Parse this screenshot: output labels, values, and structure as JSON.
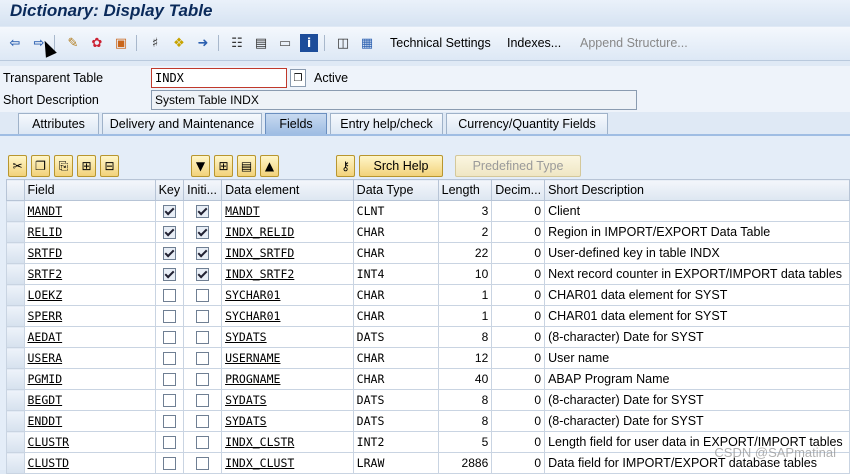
{
  "window": {
    "title": "Dictionary: Display Table"
  },
  "toolbar": {
    "technical_settings": "Technical Settings",
    "indexes": "Indexes...",
    "append_structure": "Append Structure..."
  },
  "header": {
    "table_type_label": "Transparent Table",
    "table_name": "INDX",
    "status": "Active",
    "short_desc_label": "Short Description",
    "short_desc_value": "System Table INDX"
  },
  "tabs": [
    {
      "label": "Attributes"
    },
    {
      "label": "Delivery and Maintenance"
    },
    {
      "label": "Fields",
      "active": true
    },
    {
      "label": "Entry help/check"
    },
    {
      "label": "Currency/Quantity Fields"
    }
  ],
  "grid_toolbar": {
    "srch_help": "Srch Help",
    "predefined_type": "Predefined Type"
  },
  "columns": [
    "Field",
    "Key",
    "Initi...",
    "Data element",
    "Data Type",
    "Length",
    "Decim...",
    "Short Description"
  ],
  "rows": [
    {
      "field": "MANDT",
      "key": true,
      "init": true,
      "element": "MANDT",
      "type": "CLNT",
      "length": "3",
      "dec": "0",
      "desc": "Client"
    },
    {
      "field": "RELID",
      "key": true,
      "init": true,
      "element": "INDX_RELID",
      "type": "CHAR",
      "length": "2",
      "dec": "0",
      "desc": "Region in IMPORT/EXPORT Data Table"
    },
    {
      "field": "SRTFD",
      "key": true,
      "init": true,
      "element": "INDX_SRTFD",
      "type": "CHAR",
      "length": "22",
      "dec": "0",
      "desc": "User-defined key in table INDX"
    },
    {
      "field": "SRTF2",
      "key": true,
      "init": true,
      "element": "INDX_SRTF2",
      "type": "INT4",
      "length": "10",
      "dec": "0",
      "desc": "Next record counter in EXPORT/IMPORT data tables"
    },
    {
      "field": "LOEKZ",
      "key": false,
      "init": false,
      "element": "SYCHAR01",
      "type": "CHAR",
      "length": "1",
      "dec": "0",
      "desc": "CHAR01 data element for SYST"
    },
    {
      "field": "SPERR",
      "key": false,
      "init": false,
      "element": "SYCHAR01",
      "type": "CHAR",
      "length": "1",
      "dec": "0",
      "desc": "CHAR01 data element for SYST"
    },
    {
      "field": "AEDAT",
      "key": false,
      "init": false,
      "element": "SYDATS",
      "type": "DATS",
      "length": "8",
      "dec": "0",
      "desc": "(8-character) Date for SYST"
    },
    {
      "field": "USERA",
      "key": false,
      "init": false,
      "element": "USERNAME",
      "type": "CHAR",
      "length": "12",
      "dec": "0",
      "desc": "User name"
    },
    {
      "field": "PGMID",
      "key": false,
      "init": false,
      "element": "PROGNAME",
      "type": "CHAR",
      "length": "40",
      "dec": "0",
      "desc": "ABAP Program Name"
    },
    {
      "field": "BEGDT",
      "key": false,
      "init": false,
      "element": "SYDATS",
      "type": "DATS",
      "length": "8",
      "dec": "0",
      "desc": "(8-character) Date for SYST"
    },
    {
      "field": "ENDDT",
      "key": false,
      "init": false,
      "element": "SYDATS",
      "type": "DATS",
      "length": "8",
      "dec": "0",
      "desc": "(8-character) Date for SYST"
    },
    {
      "field": "CLUSTR",
      "key": false,
      "init": false,
      "element": "INDX_CLSTR",
      "type": "INT2",
      "length": "5",
      "dec": "0",
      "desc": "Length field for user data in EXPORT/IMPORT tables"
    },
    {
      "field": "CLUSTD",
      "key": false,
      "init": false,
      "element": "INDX_CLUST",
      "type": "LRAW",
      "length": "2886",
      "dec": "0",
      "desc": "Data field for IMPORT/EXPORT database tables"
    }
  ],
  "watermark": "CSDN @SAPmatinal",
  "icons": [
    "back-icon",
    "forward-icon",
    "display-change-icon",
    "check-icon",
    "activate-icon",
    "where-used-icon",
    "object-list-icon",
    "navigate-icon",
    "hierarchy-icon",
    "print-icon",
    "display-object-icon",
    "info-icon",
    "structure-icon",
    "table-grid-icon"
  ]
}
